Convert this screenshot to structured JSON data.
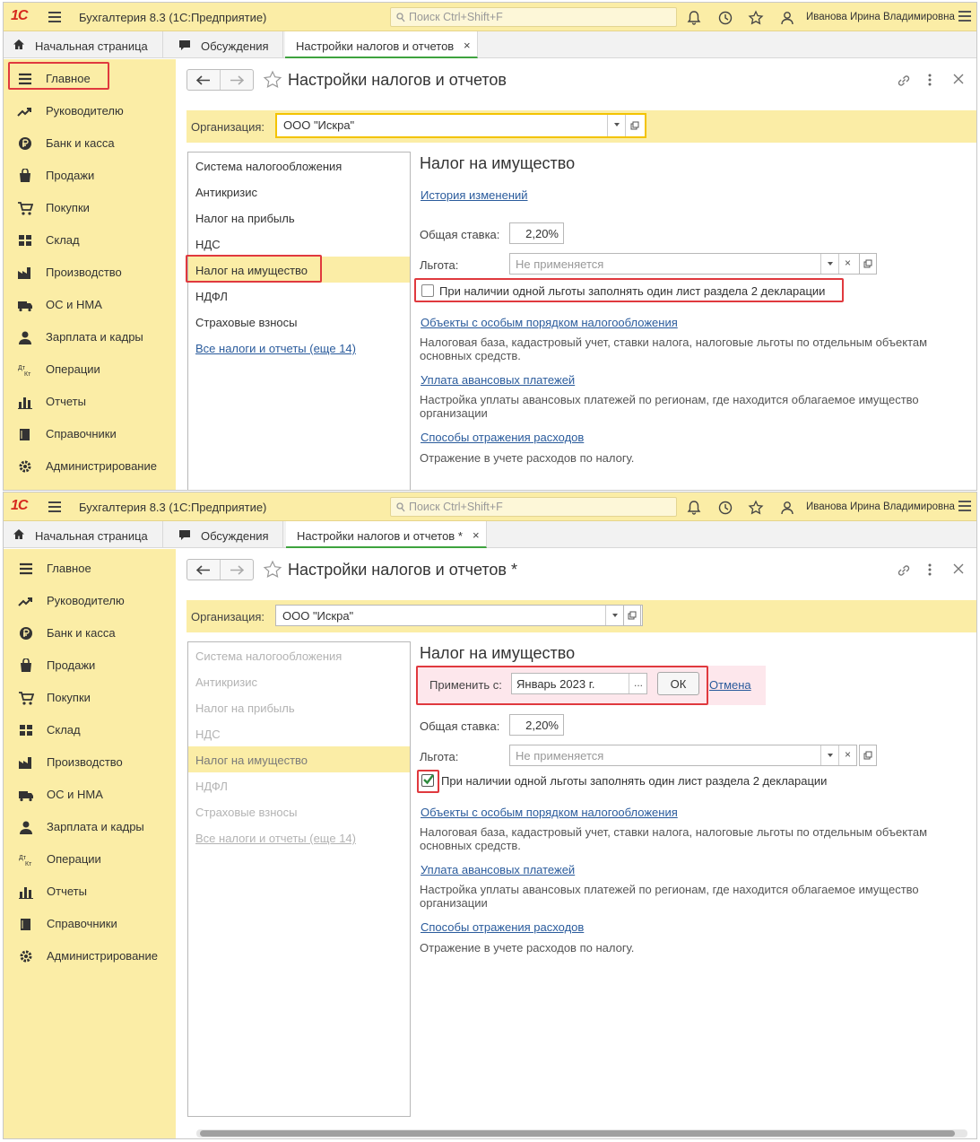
{
  "app": {
    "logo": "1С",
    "title": "Бухгалтерия 8.3  (1С:Предприятие)",
    "search_placeholder": "Поиск Ctrl+Shift+F",
    "user": "Иванова Ирина Владимировна"
  },
  "tabs": {
    "home": "Начальная страница",
    "discussions": "Обсуждения",
    "settings_w1": "Настройки налогов и отчетов",
    "settings_w2": "Настройки налогов и отчетов *",
    "close": "×"
  },
  "sidebar": {
    "items": [
      "Главное",
      "Руководителю",
      "Банк и касса",
      "Продажи",
      "Покупки",
      "Склад",
      "Производство",
      "ОС и НМА",
      "Зарплата и кадры",
      "Операции",
      "Отчеты",
      "Справочники",
      "Администрирование"
    ],
    "icons": [
      "list-icon",
      "trend-icon",
      "coin-icon",
      "bag-icon",
      "cart-icon",
      "warehouse-icon",
      "factory-icon",
      "truck-icon",
      "person-icon",
      "debit-credit-icon",
      "bar-chart-icon",
      "book-icon",
      "gear-icon"
    ]
  },
  "form": {
    "title_w1": "Настройки налогов и отчетов",
    "title_w2": "Настройки налогов и отчетов *",
    "org_label": "Организация:",
    "org_value": "ООО \"Искра\""
  },
  "sections": [
    "Система налогообложения",
    "Антикризис",
    "Налог на прибыль",
    "НДС",
    "Налог на имущество",
    "НДФЛ",
    "Страховые взносы"
  ],
  "sections_more": "Все налоги и отчеты (еще 14)",
  "panel": {
    "heading": "Налог на имущество",
    "history_link": "История изменений",
    "apply_from_label": "Применить с:",
    "apply_from_value": "Январь 2023 г.",
    "ellipsis": "...",
    "ok": "ОК",
    "cancel": "Отмена",
    "rate_label": "Общая ставка:",
    "rate_value": "2,20%",
    "benefit_label": "Льгота:",
    "benefit_placeholder": "Не применяется",
    "single_sheet_checkbox": "При наличии одной льготы заполнять один лист раздела 2 декларации",
    "objects_link": "Объекты с особым порядком налогообложения",
    "objects_desc": "Налоговая база, кадастровый учет, ставки налога, налоговые льготы по отдельным объектам основных средств.",
    "advance_link": "Уплата авансовых платежей",
    "advance_desc": "Настройка уплаты авансовых платежей по регионам, где находится облагаемое имущество организации",
    "expense_link": "Способы отражения расходов",
    "expense_desc": "Отражение в учете расходов по налогу."
  },
  "state": {
    "w1_checkbox_checked": false,
    "w2_checkbox_checked": true
  },
  "colors": {
    "brand_yellow": "#fbeda6",
    "highlight_red": "#e0393e",
    "link_blue": "#2a5b9c",
    "check_green": "#2e8b3e"
  }
}
